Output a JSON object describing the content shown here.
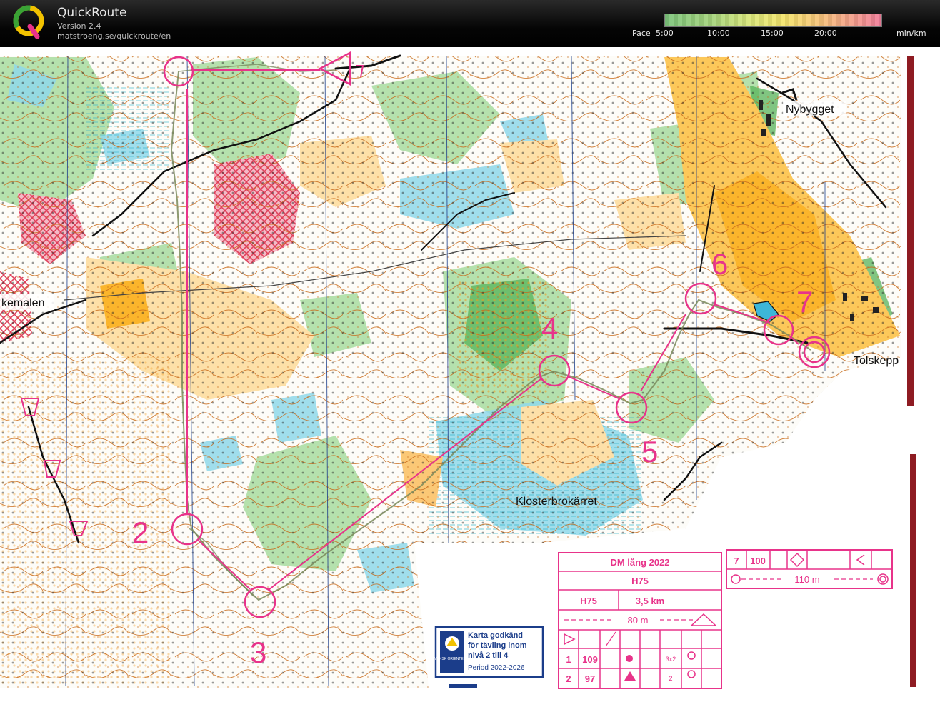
{
  "app": {
    "title": "QuickRoute",
    "version": "Version 2.4",
    "url": "matstroeng.se/quickroute/en"
  },
  "pace_scale": {
    "label": "Pace",
    "ticks": [
      "5:00",
      "10:00",
      "15:00",
      "20:00"
    ],
    "unit": "min/km"
  },
  "map": {
    "place_names": {
      "nybygget": "Nybygget",
      "tolskepp": "Tolskepp",
      "klosterbrokarret": "Klosterbrokärret",
      "kemalen": "kemalen"
    },
    "control_numbers": [
      "2",
      "3",
      "4",
      "5",
      "6",
      "7"
    ],
    "colors": {
      "course": "#e8338a",
      "open_land": "#fbb52c",
      "forest_green": "#9fd79a",
      "water": "#8fd8ea",
      "contour": "#c86a1a"
    }
  },
  "course_card": {
    "event": "DM lång 2022",
    "class": "H75",
    "class2": "H75",
    "length": "3,5 km",
    "start_dist": "80 m",
    "finish_control": "7",
    "finish_code": "100",
    "finish_dist": "110 m",
    "rows": [
      {
        "num": "1",
        "code": "109",
        "sym": "3x2"
      },
      {
        "num": "2",
        "code": "97",
        "sym": "2"
      }
    ]
  },
  "approval_badge": {
    "line1": "Karta godkänd",
    "line2": "för tävling inom",
    "line3": "nivå 2 till 4",
    "line4": "Period 2022-2026",
    "logo_text": "SVENSK ORIENTERING"
  }
}
